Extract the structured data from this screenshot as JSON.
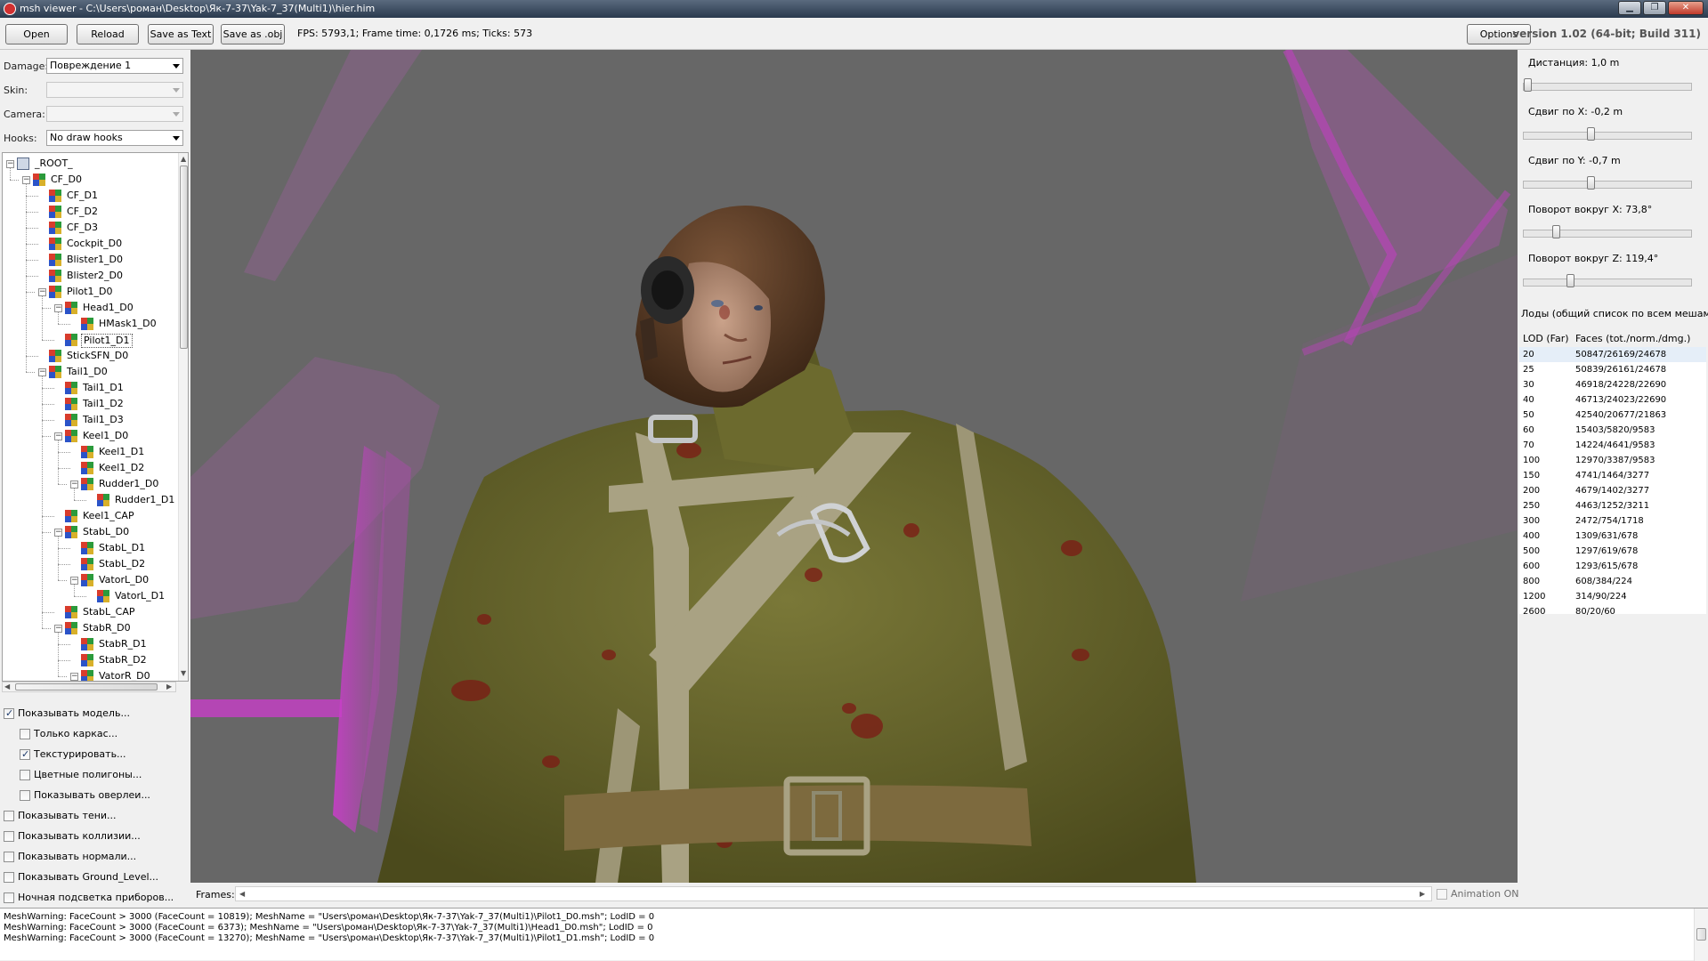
{
  "window": {
    "title": "msh viewer - C:\\Users\\роман\\Desktop\\Як-7-37\\Yak-7_37(Multi1)\\hier.him"
  },
  "toolbar": {
    "open": "Open",
    "reload": "Reload",
    "save_text": "Save as Text",
    "save_obj": "Save as .obj",
    "stats": "FPS: 5793,1; Frame time: 0,1726 ms; Ticks: 573",
    "options": "Options",
    "version": "version 1.02 (64-bit; Build 311)"
  },
  "left": {
    "damage_label": "Damage:",
    "damage_value": "Повреждение 1",
    "skin_label": "Skin:",
    "skin_value": "",
    "camera_label": "Camera:",
    "camera_value": "",
    "hooks_label": "Hooks:",
    "hooks_value": "No draw hooks"
  },
  "tree": [
    {
      "label": "_ROOT_",
      "level": 0,
      "expanded": true,
      "icon": "root-icon"
    },
    {
      "label": "CF_D0",
      "level": 1,
      "expanded": true,
      "icon": "mesh-icon"
    },
    {
      "label": "CF_D1",
      "level": 2,
      "icon": "mesh-icon"
    },
    {
      "label": "CF_D2",
      "level": 2,
      "icon": "mesh-icon"
    },
    {
      "label": "CF_D3",
      "level": 2,
      "icon": "mesh-icon"
    },
    {
      "label": "Cockpit_D0",
      "level": 2,
      "icon": "mesh-icon"
    },
    {
      "label": "Blister1_D0",
      "level": 2,
      "icon": "mesh-icon"
    },
    {
      "label": "Blister2_D0",
      "level": 2,
      "icon": "mesh-icon"
    },
    {
      "label": "Pilot1_D0",
      "level": 2,
      "expanded": true,
      "icon": "mesh-icon"
    },
    {
      "label": "Head1_D0",
      "level": 3,
      "expanded": true,
      "icon": "mesh-icon"
    },
    {
      "label": "HMask1_D0",
      "level": 4,
      "icon": "mesh-icon"
    },
    {
      "label": "Pilot1_D1",
      "level": 3,
      "icon": "mesh-icon",
      "selected": true
    },
    {
      "label": "StickSFN_D0",
      "level": 2,
      "icon": "mesh-icon"
    },
    {
      "label": "Tail1_D0",
      "level": 2,
      "expanded": true,
      "icon": "mesh-icon"
    },
    {
      "label": "Tail1_D1",
      "level": 3,
      "icon": "mesh-icon"
    },
    {
      "label": "Tail1_D2",
      "level": 3,
      "icon": "mesh-icon"
    },
    {
      "label": "Tail1_D3",
      "level": 3,
      "icon": "mesh-icon"
    },
    {
      "label": "Keel1_D0",
      "level": 3,
      "expanded": true,
      "icon": "mesh-icon"
    },
    {
      "label": "Keel1_D1",
      "level": 4,
      "icon": "mesh-icon"
    },
    {
      "label": "Keel1_D2",
      "level": 4,
      "icon": "mesh-icon"
    },
    {
      "label": "Rudder1_D0",
      "level": 4,
      "expanded": true,
      "icon": "mesh-icon"
    },
    {
      "label": "Rudder1_D1",
      "level": 5,
      "icon": "mesh-icon"
    },
    {
      "label": "Keel1_CAP",
      "level": 3,
      "icon": "mesh-icon"
    },
    {
      "label": "StabL_D0",
      "level": 3,
      "expanded": true,
      "icon": "mesh-icon"
    },
    {
      "label": "StabL_D1",
      "level": 4,
      "icon": "mesh-icon"
    },
    {
      "label": "StabL_D2",
      "level": 4,
      "icon": "mesh-icon"
    },
    {
      "label": "VatorL_D0",
      "level": 4,
      "expanded": true,
      "icon": "mesh-icon"
    },
    {
      "label": "VatorL_D1",
      "level": 5,
      "icon": "mesh-icon"
    },
    {
      "label": "StabL_CAP",
      "level": 3,
      "icon": "mesh-icon"
    },
    {
      "label": "StabR_D0",
      "level": 3,
      "expanded": true,
      "icon": "mesh-icon"
    },
    {
      "label": "StabR_D1",
      "level": 4,
      "icon": "mesh-icon"
    },
    {
      "label": "StabR_D2",
      "level": 4,
      "icon": "mesh-icon"
    },
    {
      "label": "VatorR_D0",
      "level": 4,
      "expanded": true,
      "icon": "mesh-icon"
    }
  ],
  "checkboxes": [
    {
      "label": "Показывать модель...",
      "checked": true,
      "indent": 0
    },
    {
      "label": "Только каркас...",
      "checked": false,
      "indent": 1
    },
    {
      "label": "Текстурировать...",
      "checked": true,
      "indent": 1
    },
    {
      "label": "Цветные полигоны...",
      "checked": false,
      "indent": 1
    },
    {
      "label": "Показывать оверлеи...",
      "checked": false,
      "indent": 1
    },
    {
      "label": "Показывать тени...",
      "checked": false,
      "indent": 0
    },
    {
      "label": "Показывать коллизии...",
      "checked": false,
      "indent": 0
    },
    {
      "label": "Показывать нормали...",
      "checked": false,
      "indent": 0
    },
    {
      "label": "Показывать Ground_Level...",
      "checked": false,
      "indent": 0
    },
    {
      "label": "Ночная подсветка приборов...",
      "checked": false,
      "indent": 0
    }
  ],
  "right": {
    "sliders": [
      {
        "label": "Дистанция:",
        "value": "1,0 m",
        "level": 0.0
      },
      {
        "label": "Сдвиг по X:",
        "value": "-0,2 m",
        "level": 0.4
      },
      {
        "label": "Сдвиг по Y:",
        "value": "-0,7 m",
        "level": 0.4
      },
      {
        "label": "Поворот вокруг X:",
        "value": "73,8°",
        "level": 0.18
      },
      {
        "label": "Поворот вокруг Z:",
        "value": "119,4°",
        "level": 0.27
      }
    ],
    "lods_title": "Лоды (общий список по всем мешам):",
    "lod_col1": "LOD (Far)",
    "lod_col2": "Faces (tot./norm./dmg.)",
    "lods": [
      {
        "far": "20",
        "faces": "50847/26169/24678"
      },
      {
        "far": "25",
        "faces": "50839/26161/24678"
      },
      {
        "far": "30",
        "faces": "46918/24228/22690"
      },
      {
        "far": "40",
        "faces": "46713/24023/22690"
      },
      {
        "far": "50",
        "faces": "42540/20677/21863"
      },
      {
        "far": "60",
        "faces": "15403/5820/9583"
      },
      {
        "far": "70",
        "faces": "14224/4641/9583"
      },
      {
        "far": "100",
        "faces": "12970/3387/9583"
      },
      {
        "far": "150",
        "faces": "4741/1464/3277"
      },
      {
        "far": "200",
        "faces": "4679/1402/3277"
      },
      {
        "far": "250",
        "faces": "4463/1252/3211"
      },
      {
        "far": "300",
        "faces": "2472/754/1718"
      },
      {
        "far": "400",
        "faces": "1309/631/678"
      },
      {
        "far": "500",
        "faces": "1297/619/678"
      },
      {
        "far": "600",
        "faces": "1293/615/678"
      },
      {
        "far": "800",
        "faces": "608/384/224"
      },
      {
        "far": "1200",
        "faces": "314/90/224"
      },
      {
        "far": "2600",
        "faces": "80/20/60"
      }
    ]
  },
  "frames": {
    "label": "Frames:",
    "anim_label": "Animation ON"
  },
  "log": [
    "MeshWarning: FaceCount > 3000 (FaceCount = 10819); MeshName = \"Users\\роман\\Desktop\\Як-7-37\\Yak-7_37(Multi1)\\Pilot1_D0.msh\"; LodID = 0",
    "MeshWarning: FaceCount > 3000 (FaceCount = 6373); MeshName = \"Users\\роман\\Desktop\\Як-7-37\\Yak-7_37(Multi1)\\Head1_D0.msh\"; LodID = 0",
    "MeshWarning: FaceCount > 3000 (FaceCount = 13270); MeshName = \"Users\\роман\\Desktop\\Як-7-37\\Yak-7_37(Multi1)\\Pilot1_D1.msh\"; LodID = 0"
  ],
  "colors": {
    "viewport_bg": "#676767",
    "overlay_magenta": "#c83ec8",
    "uniform_olive": "#66652a",
    "strap_khaki": "#a9a283",
    "helmet_brown": "#5a3a22",
    "blood_red": "#7c1a14"
  }
}
